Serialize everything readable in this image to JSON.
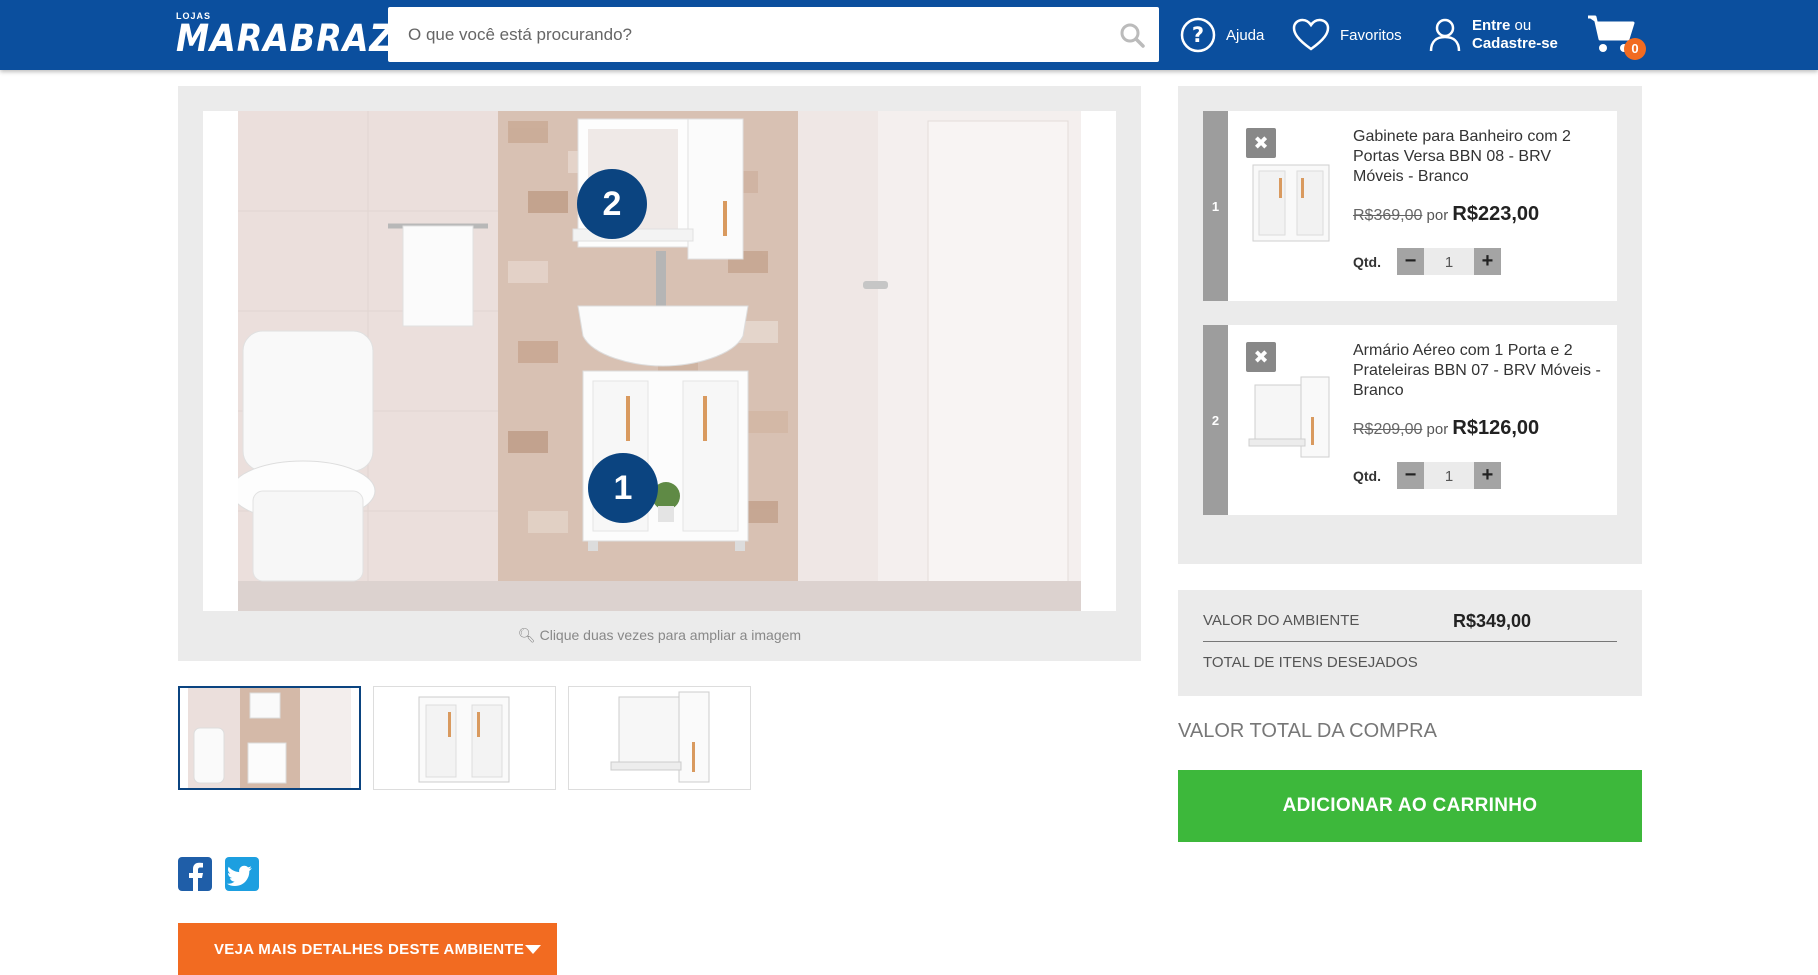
{
  "header": {
    "logo_small": "LOJAS",
    "logo_main": "MARABRAZ",
    "search_placeholder": "O que você está procurando?",
    "help_label": "Ajuda",
    "favorites_label": "Favoritos",
    "login_bold1": "Entre",
    "login_rest1": " ou",
    "login_bold2": "Cadastre-se",
    "cart_count": "0",
    "brand_color": "#0b4f9e"
  },
  "gallery": {
    "hint": "Clique duas vezes para ampliar a imagem",
    "pins": [
      "2",
      "1"
    ]
  },
  "thumbnails": [
    "ambiente",
    "gabinete",
    "armario"
  ],
  "details_button": "VEJA MAIS DETALHES DESTE AMBIENTE",
  "items": [
    {
      "number": "1",
      "remove": "✖",
      "title": "Gabinete para Banheiro com 2 Portas Versa BBN 08 - BRV Móveis - Branco",
      "old_price": "R$369,00",
      "por": " por ",
      "price": "R$223,00",
      "qty_label": "Qtd.",
      "qty_value": "1",
      "minus": "−",
      "plus": "+"
    },
    {
      "number": "2",
      "remove": "✖",
      "title": "Armário Aéreo com 1 Porta e 2 Prateleiras BBN 07 - BRV Móveis - Branco",
      "old_price": "R$209,00",
      "por": " por ",
      "price": "R$126,00",
      "qty_label": "Qtd.",
      "qty_value": "1",
      "minus": "−",
      "plus": "+"
    }
  ],
  "summary": {
    "value_label": "VALOR DO AMBIENTE",
    "value": "R$349,00",
    "items_label": "TOTAL DE ITENS DESEJADOS"
  },
  "total_label": "VALOR TOTAL DA COMPRA",
  "cta_label": "ADICIONAR AO CARRINHO",
  "colors": {
    "accent_orange": "#f26b21",
    "cta_green": "#3db83b",
    "pin_blue": "#0b4480"
  }
}
